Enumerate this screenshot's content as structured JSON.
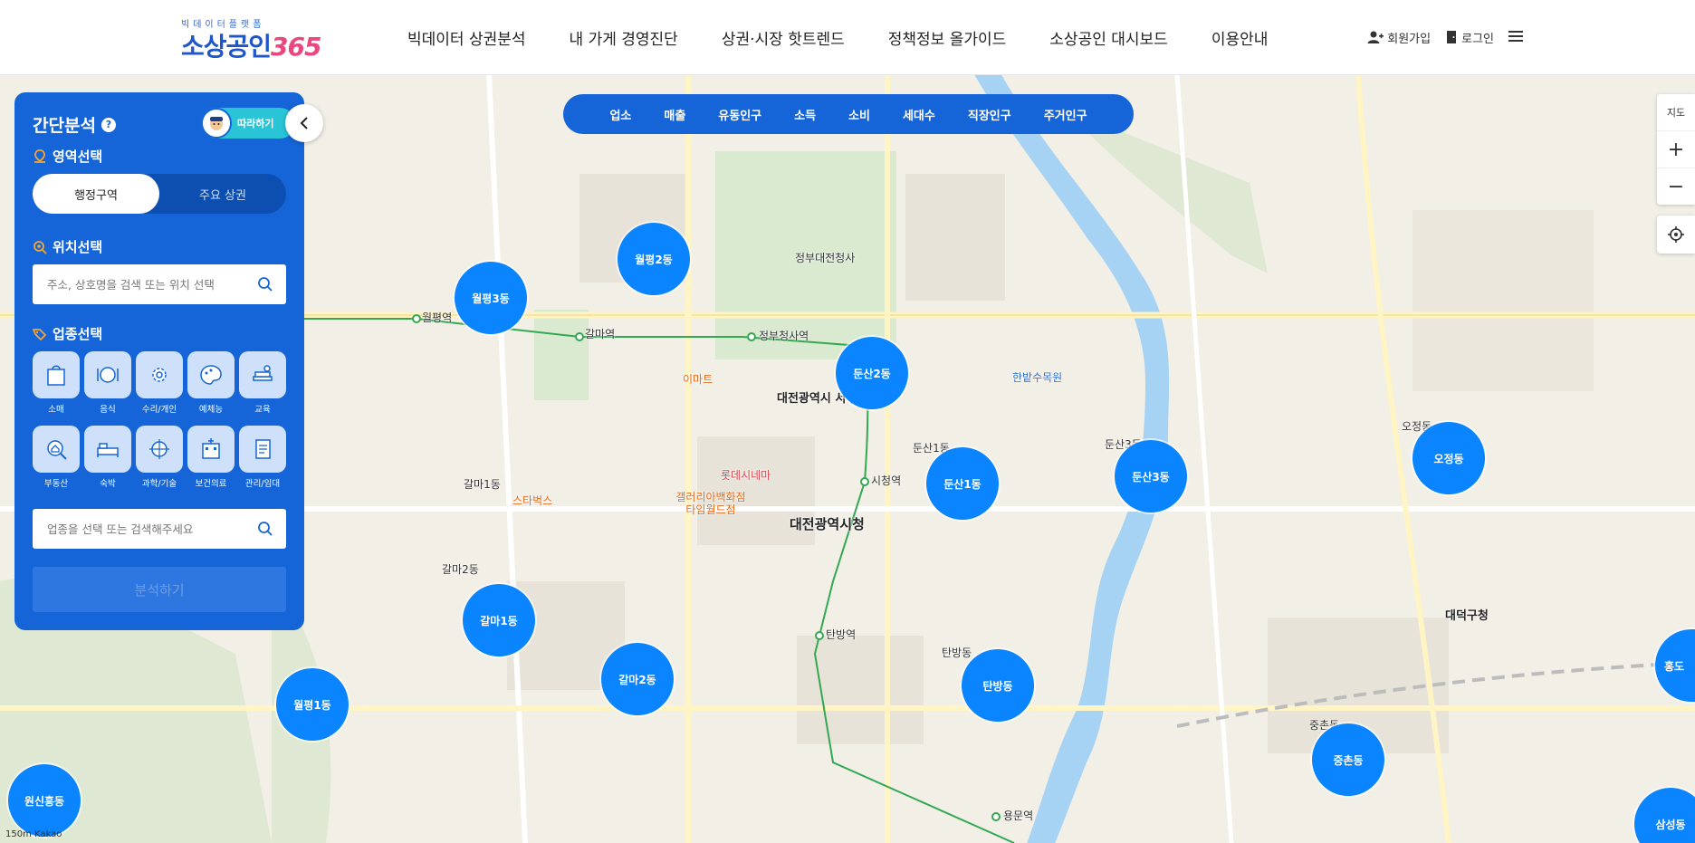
{
  "header": {
    "logo_sub": "빅데이터플랫폼",
    "logo_main": "소상공인",
    "logo_num": "365",
    "nav": [
      "빅데이터 상권분석",
      "내 가게 경영진단",
      "상권·시장 핫트렌드",
      "정책정보 올가이드",
      "소상공인 대시보드",
      "이용안내"
    ],
    "signup_label": "회원가입",
    "login_label": "로그인"
  },
  "map_categories": [
    "업소",
    "매출",
    "유동인구",
    "소득",
    "소비",
    "세대수",
    "직장인구",
    "주거인구"
  ],
  "map_controls": {
    "map_type_label": "지도",
    "zoom_in": "+",
    "zoom_out": "−"
  },
  "panel": {
    "title": "간단분석",
    "help": "?",
    "follow_label": "따라하기",
    "area_title": "영역선택",
    "area_tabs": [
      "행정구역",
      "주요 상권"
    ],
    "location_title": "위치선택",
    "location_placeholder": "주소, 상호명을 검색 또는 위치 선택",
    "industry_title": "업종선택",
    "categories": [
      "소매",
      "음식",
      "수리/개인",
      "예체능",
      "교육",
      "부동산",
      "숙박",
      "과학/기술",
      "보건의료",
      "관리/임대"
    ],
    "industry_placeholder": "업종을 선택 또는 검색해주세요",
    "analyze_label": "분석하기"
  },
  "clusters": [
    "월평2동",
    "월평3동",
    "둔산2동",
    "둔산1동",
    "둔산3동",
    "오정동",
    "갈마1동",
    "갈마2동",
    "월평1동",
    "탄방동",
    "중촌동",
    "원신흥동",
    "삼성동",
    "홍도"
  ],
  "map_labels": {
    "daejeon_city_hall": "대전광역시청",
    "seo_gu_office": "대전광역시 서구청",
    "daedeok_gu_office": "대덕구청",
    "galma_station": "갈마역",
    "wolpyeong_station": "월평역",
    "jeongbu_station": "정부청사역",
    "sicheong_station": "시청역",
    "tanbang_station": "탄방역",
    "yongmun_station": "용문역",
    "government_complex": "정부대전청사",
    "hanbat_arboretum": "한밭수목원",
    "dunsan_1_dong_label": "둔산1동",
    "dunsan_3_dong_label": "둔산3동",
    "galma_1_dong_label": "갈마1동",
    "galma_2_dong_label": "갈마2동",
    "tanbang_dong_label": "탄방동",
    "jungchon_dong_label": "중촌동",
    "ojeong_dong_label": "오정동",
    "galleria_timeworld": "갤러리아백화점 타임월드점",
    "lotte_cinema": "롯데시네마",
    "starbucks": "스타벅스",
    "emart": "이마트",
    "kakao_scale": "150m Kakao"
  }
}
